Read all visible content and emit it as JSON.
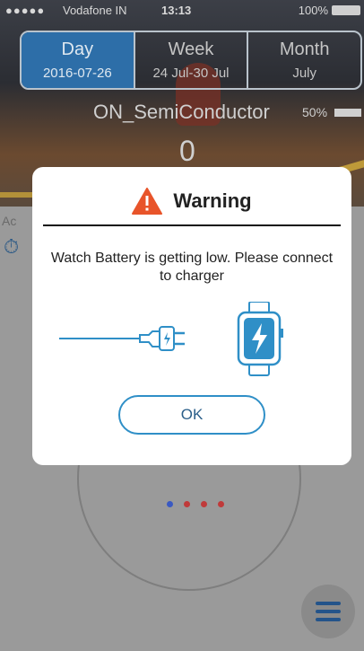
{
  "status_bar": {
    "signal": "●●●●●",
    "carrier": "Vodafone IN",
    "time": "13:13",
    "battery": "100%"
  },
  "range_tabs": [
    {
      "label": "Day",
      "sub": "2016-07-26",
      "active": true
    },
    {
      "label": "Week",
      "sub": "24 Jul-30 Jul",
      "active": false
    },
    {
      "label": "Month",
      "sub": "July",
      "active": false
    }
  ],
  "device": {
    "name": "ON_SemiConductor",
    "battery": "50%"
  },
  "step_count": "0",
  "activity": {
    "label": "Ac",
    "icon": "timer-icon"
  },
  "page_dots": [
    {
      "color": "#3a59c2"
    },
    {
      "color": "#c03a3a"
    },
    {
      "color": "#c03a3a"
    },
    {
      "color": "#c03a3a"
    }
  ],
  "menu_icon": "hamburger-menu-icon",
  "warning": {
    "icon": "warning-triangle-icon",
    "title": "Warning",
    "message": "Watch Battery is getting low. Please connect to charger",
    "illustration": [
      "charger-plug-icon",
      "smartwatch-charging-icon"
    ],
    "ok_label": "OK"
  },
  "colors": {
    "accent": "#2d6ea8",
    "warning": "#e8542a",
    "button_border": "#2f8fc7"
  }
}
